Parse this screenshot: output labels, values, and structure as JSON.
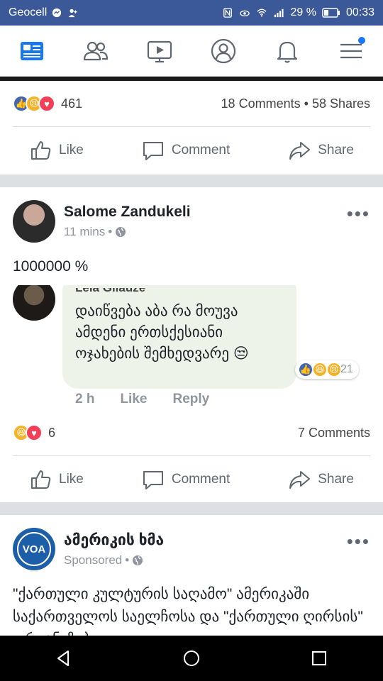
{
  "status_bar": {
    "carrier": "Geocell",
    "battery": "29 %",
    "time": "00:33"
  },
  "nav": {
    "items": [
      "news-feed",
      "friends",
      "watch",
      "profile",
      "notifications",
      "menu"
    ]
  },
  "post1": {
    "reaction_count": "461",
    "comments": "18 Comments",
    "shares": "58 Shares",
    "separator": "•"
  },
  "actions": {
    "like": "Like",
    "comment": "Comment",
    "share": "Share"
  },
  "post2": {
    "author": "Salome Zandukeli",
    "time": "11 mins",
    "separator": "•",
    "text": "1000000 %",
    "embedded_comment": {
      "author": "Leia Gilauze",
      "text": "დაიწვება აბა რა მოუვა ამდენი ერთსქესიანი ოჯახების შემხედვარე 😒",
      "reaction_count": "21",
      "time": "2 h",
      "like": "Like",
      "reply": "Reply"
    },
    "reaction_count": "6",
    "comments": "7 Comments"
  },
  "post3": {
    "author": "ამერიკის ხმა",
    "meta": "Sponsored",
    "separator": "•",
    "avatar_text": "VOA",
    "text": "\"ქართული კულტურის საღამო\" ამერიკაში საქართველოს საელჩოსა და \"ქართული ღირსის\" ორგანიზებით"
  },
  "colors": {
    "status_bar": "#3b5998",
    "accent": "#1877f2",
    "muted": "#90949c"
  }
}
